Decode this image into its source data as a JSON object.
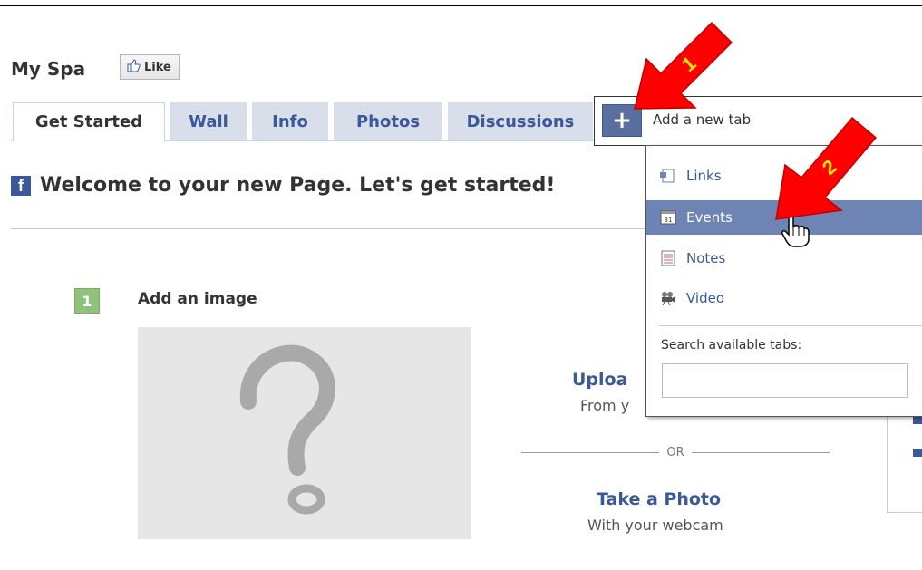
{
  "page": {
    "name": "My Spa",
    "like_label": "Like"
  },
  "tabs": [
    {
      "label": "Get Started",
      "active": true
    },
    {
      "label": "Wall",
      "active": false
    },
    {
      "label": "Info",
      "active": false
    },
    {
      "label": "Photos",
      "active": false
    },
    {
      "label": "Discussions",
      "active": false
    }
  ],
  "add_tab": {
    "plus": "+",
    "label": "Add a new tab"
  },
  "dropdown": {
    "items": [
      {
        "label": "Links",
        "icon": "links-icon"
      },
      {
        "label": "Events",
        "icon": "calendar-icon",
        "highlighted": true
      },
      {
        "label": "Notes",
        "icon": "notes-icon"
      },
      {
        "label": "Video",
        "icon": "video-camera-icon"
      }
    ],
    "search_label": "Search available tabs:",
    "search_value": ""
  },
  "welcome": {
    "logo_letter": "f",
    "title": "Welcome to your new Page. Let's get started!"
  },
  "step": {
    "number": "1",
    "title": "Add an image"
  },
  "upload": {
    "title": "Uploa",
    "subtitle": "From y"
  },
  "or_label": "OR",
  "photo": {
    "title": "Take a Photo",
    "subtitle": "With your webcam"
  },
  "callouts": [
    {
      "number": "1"
    },
    {
      "number": "2"
    }
  ],
  "colors": {
    "brand": "#3b5998",
    "tab_bg": "#d8dfea",
    "highlight": "#6d84b4",
    "step_green": "#8fc27c",
    "arrow_red": "#ff0000"
  }
}
